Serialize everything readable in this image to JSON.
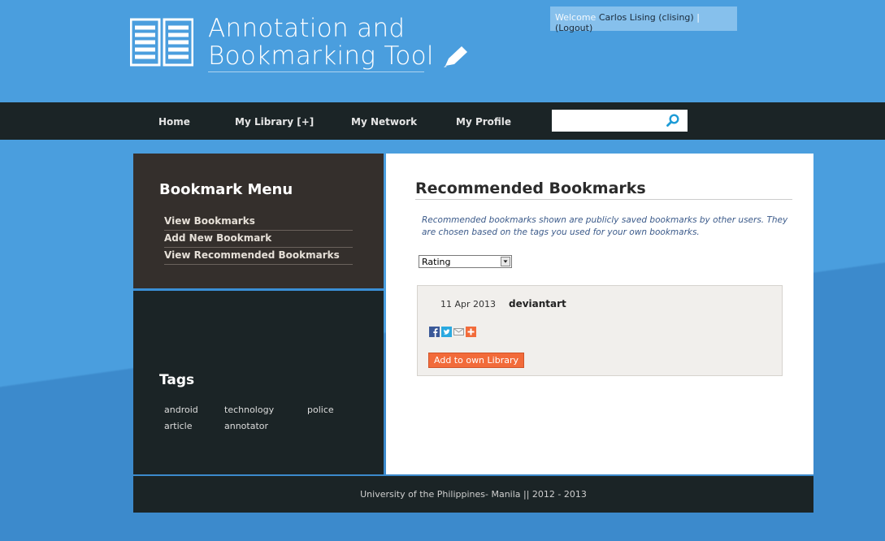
{
  "header": {
    "title_line1": "Annotation and",
    "title_line2": "Bookmarking Tool",
    "welcome_label": "Welcome",
    "username": "Carlos Lising (clising)",
    "separator": "|",
    "logout": "(Logout)"
  },
  "nav": {
    "items": [
      {
        "label": "Home"
      },
      {
        "label": "My Library [+]"
      },
      {
        "label": "My Network"
      },
      {
        "label": "My Profile"
      }
    ],
    "search_value": ""
  },
  "sidebar": {
    "menu_heading": "Bookmark Menu",
    "menu_items": [
      {
        "label": "View Bookmarks"
      },
      {
        "label": "Add New Bookmark"
      },
      {
        "label": "View Recommended Bookmarks"
      }
    ],
    "tags_heading": "Tags",
    "tags": [
      "android",
      "technology",
      "police",
      "article",
      "annotator"
    ]
  },
  "main": {
    "title": "Recommended Bookmarks",
    "description": "Recommended bookmarks shown are publicly saved bookmarks by other users. They are chosen based on the tags you used for your own bookmarks.",
    "sort_value": "Rating",
    "bookmarks": [
      {
        "date": "11 Apr 2013",
        "title": "deviantart",
        "action": "Add to own Library"
      }
    ]
  },
  "footer": {
    "text": "University of the Philippines- Manila || 2012 - 2013"
  },
  "colors": {
    "background": "#4a9ede",
    "nav": "#1b2426",
    "sidebar_top": "#342f2c",
    "accent_button": "#f26b3a"
  }
}
